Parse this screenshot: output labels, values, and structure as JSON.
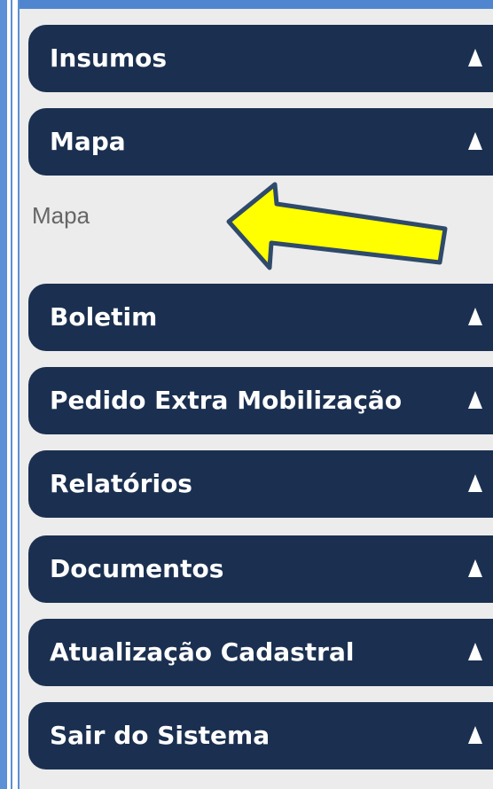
{
  "menu": {
    "items": [
      {
        "label": "Insumos",
        "expanded": false
      },
      {
        "label": "Mapa",
        "expanded": true,
        "subitems": [
          {
            "label": "Mapa"
          }
        ]
      },
      {
        "label": "Boletim",
        "expanded": false
      },
      {
        "label": "Pedido Extra Mobilização",
        "expanded": false
      },
      {
        "label": "Relatórios",
        "expanded": false
      },
      {
        "label": "Documentos",
        "expanded": false
      },
      {
        "label": "Atualização Cadastral",
        "expanded": false
      },
      {
        "label": "Sair do Sistema",
        "expanded": false
      }
    ]
  },
  "icons": {
    "caret": "caret-up-icon",
    "annotation": "yellow-arrow-icon"
  },
  "colors": {
    "header_bg": "#1b3050",
    "header_text": "#ffffff",
    "sidebar_bg": "#ececec",
    "frame_blue": "#4f86cf",
    "sublink_text": "#666666",
    "arrow_fill": "#ffff00",
    "arrow_stroke": "#2f4a6b"
  }
}
